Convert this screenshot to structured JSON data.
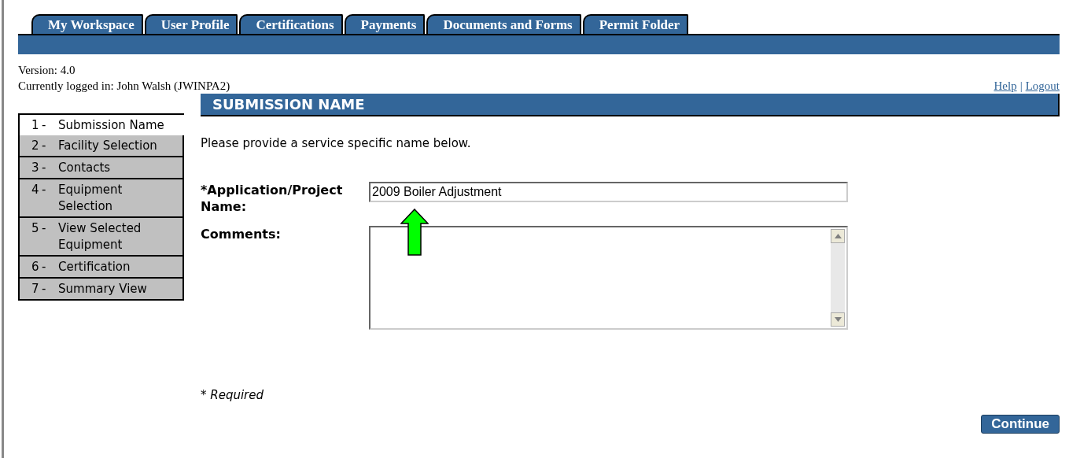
{
  "tabs": [
    {
      "label": "My Workspace"
    },
    {
      "label": "User Profile"
    },
    {
      "label": "Certifications"
    },
    {
      "label": "Payments"
    },
    {
      "label": "Documents and Forms"
    },
    {
      "label": "Permit Folder"
    }
  ],
  "version": "Version: 4.0",
  "logged_in": "Currently logged in: John Walsh (JWINPA2)",
  "links": [
    {
      "label": "Help"
    },
    {
      "label": "Logout"
    }
  ],
  "link_separator": "|",
  "steps": [
    {
      "number": "1",
      "separator": "-",
      "label": "Submission Name",
      "selected": true
    },
    {
      "number": "2",
      "separator": "-",
      "label": "Facility Selection",
      "selected": false
    },
    {
      "number": "3",
      "separator": "-",
      "label": "Contacts",
      "selected": false
    },
    {
      "number": "4",
      "separator": "-",
      "label": "Equipment Selection",
      "selected": false
    },
    {
      "number": "5",
      "separator": "-",
      "label": "View Selected Equipment",
      "selected": false
    },
    {
      "number": "6",
      "separator": "-",
      "label": "Certification",
      "selected": false
    },
    {
      "number": "7",
      "separator": "-",
      "label": "Summary View",
      "selected": false
    }
  ],
  "section_title": "SUBMISSION NAME",
  "intro": "Please provide a service specific name below.",
  "fields": [
    {
      "kind": "text",
      "label": "*Application/Project Name:",
      "value": "2009 Boiler Adjustment"
    },
    {
      "kind": "textarea",
      "label": "Comments:"
    }
  ],
  "required_note": "* Required",
  "continue_button": "Continue"
}
